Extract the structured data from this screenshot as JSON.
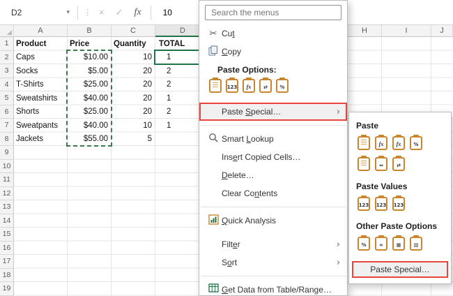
{
  "formula_bar": {
    "name_box": "D2",
    "value": "10",
    "icons": {
      "dropdown": "▾",
      "dots": "⋮",
      "cancel": "×",
      "confirm": "✓",
      "fx": "fx"
    }
  },
  "grid": {
    "column_headers": [
      "A",
      "B",
      "C",
      "D"
    ],
    "right_column_headers": [
      "H",
      "I",
      "J"
    ],
    "row_numbers": [
      "1",
      "2",
      "3",
      "4",
      "5",
      "6",
      "7",
      "8",
      "9",
      "10",
      "11",
      "12",
      "13",
      "14",
      "15",
      "16",
      "17",
      "18",
      "19"
    ],
    "rows": [
      {
        "a": "Product",
        "b": "Price",
        "c": "Quantity",
        "d": "TOTAL"
      },
      {
        "a": "Caps",
        "b": "$10.00",
        "c": "10",
        "d": "1"
      },
      {
        "a": "Socks",
        "b": "$5.00",
        "c": "20",
        "d": "2"
      },
      {
        "a": "T-Shirts",
        "b": "$25.00",
        "c": "20",
        "d": "2"
      },
      {
        "a": "Sweatshirts",
        "b": "$40.00",
        "c": "20",
        "d": "1"
      },
      {
        "a": "Shorts",
        "b": "$25.00",
        "c": "20",
        "d": "2"
      },
      {
        "a": "Sweatpants",
        "b": "$40.00",
        "c": "10",
        "d": "1"
      },
      {
        "a": "Jackets",
        "b": "$55.00",
        "c": "5",
        "d": ""
      }
    ]
  },
  "context_menu": {
    "search_placeholder": "Search the menus",
    "icons": {
      "cut": "✂",
      "chevron": "›"
    },
    "items": {
      "cut": {
        "pre": "Cu",
        "accel": "t",
        "post": ""
      },
      "copy": {
        "pre": "",
        "accel": "C",
        "post": "opy"
      },
      "paste_options_label": "Paste Options:",
      "paste_special": {
        "pre": "Paste ",
        "accel": "S",
        "post": "pecial…"
      },
      "smart_lookup": {
        "pre": "Smart ",
        "accel": "L",
        "post": "ookup"
      },
      "insert_copied_cells": {
        "pre": "Ins",
        "accel": "e",
        "post": "rt Copied Cells…"
      },
      "delete": {
        "pre": "",
        "accel": "D",
        "post": "elete…"
      },
      "clear_contents": {
        "pre": "Clear Co",
        "accel": "n",
        "post": "tents"
      },
      "quick_analysis": {
        "pre": "",
        "accel": "Q",
        "post": "uick Analysis"
      },
      "filter": {
        "pre": "Filt",
        "accel": "e",
        "post": "r"
      },
      "sort": {
        "pre": "S",
        "accel": "o",
        "post": "rt"
      },
      "get_data": {
        "pre": "",
        "accel": "G",
        "post": "et Data from Table/Range…"
      }
    },
    "paste_icons": [
      {
        "name": "paste-icon",
        "glyph": ""
      },
      {
        "name": "paste-values-icon",
        "glyph": "123"
      },
      {
        "name": "paste-formulas-icon",
        "glyph": "fx"
      },
      {
        "name": "paste-transpose-icon",
        "glyph": "⇄"
      },
      {
        "name": "paste-formatting-icon",
        "glyph": "%"
      }
    ]
  },
  "submenu": {
    "sections": {
      "paste": {
        "title": "Paste",
        "row1": [
          {
            "name": "paste-icon",
            "glyph": ""
          },
          {
            "name": "formulas-icon",
            "glyph": "fx"
          },
          {
            "name": "formulas-number-formatting-icon",
            "glyph": "fx"
          },
          {
            "name": "keep-source-formatting-icon",
            "glyph": "%"
          }
        ],
        "row2": [
          {
            "name": "no-borders-icon",
            "glyph": ""
          },
          {
            "name": "keep-source-column-widths-icon",
            "glyph": "⇔"
          },
          {
            "name": "transpose-icon",
            "glyph": "⇄"
          }
        ]
      },
      "values": {
        "title": "Paste Values",
        "row": [
          {
            "name": "values-icon",
            "glyph": "123"
          },
          {
            "name": "values-number-formatting-icon",
            "glyph": "123"
          },
          {
            "name": "values-source-formatting-icon",
            "glyph": "123"
          }
        ]
      },
      "other": {
        "title": "Other Paste Options",
        "row": [
          {
            "name": "formatting-icon",
            "glyph": "%"
          },
          {
            "name": "paste-link-icon",
            "glyph": "∞"
          },
          {
            "name": "picture-icon",
            "glyph": "▦"
          },
          {
            "name": "linked-picture-icon",
            "glyph": "▧"
          }
        ]
      }
    },
    "paste_special_label": "Paste Special…"
  },
  "colors": {
    "selection_green": "#217346",
    "highlight_red": "#e8453c",
    "clipboard_amber": "#c9862e"
  }
}
